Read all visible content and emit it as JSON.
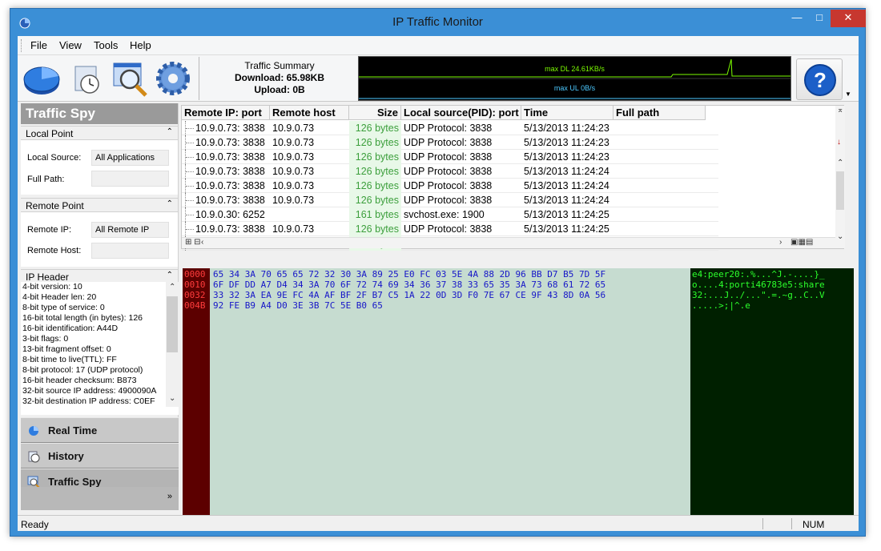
{
  "window": {
    "title": "IP Traffic Monitor"
  },
  "menu": {
    "items": [
      "File",
      "View",
      "Tools",
      "Help"
    ]
  },
  "toolbar": {
    "summary_title": "Traffic Summary",
    "download": "Download: 65.98KB",
    "upload": "Upload: 0B",
    "graph_dl": "max DL 24.61KB/s",
    "graph_ul": "max UL 0B/s",
    "icons": [
      "pie-chart-icon",
      "clock-icon",
      "magnifier-icon",
      "gear-icon",
      "help-icon"
    ]
  },
  "sidebar": {
    "title": "Traffic Spy",
    "local_point": {
      "header": "Local Point",
      "source_label": "Local Source:",
      "source_value": "All Applications",
      "path_label": "Full Path:",
      "path_value": ""
    },
    "remote_point": {
      "header": "Remote Point",
      "ip_label": "Remote IP:",
      "ip_value": "All Remote IP",
      "host_label": "Remote Host:",
      "host_value": ""
    },
    "ip_header": {
      "header": "IP Header",
      "lines": [
        "4-bit version: 10",
        "4-bit Header len: 20",
        "8-bit type of service: 0",
        "16-bit total length (in bytes): 126",
        "16-bit identification: A44D",
        "3-bit flags: 0",
        "13-bit fragment offset: 0",
        "8-bit time to live(TTL): FF",
        "8-bit protocol: 17 (UDP protocol)",
        "16-bit header checksum: B873",
        "32-bit source IP address: 4900090A",
        "32-bit destination IP address: C0EF"
      ]
    },
    "nav": [
      "Real Time",
      "History",
      "Traffic Spy"
    ]
  },
  "table": {
    "columns": [
      "Remote IP: port",
      "Remote host",
      "Size",
      "Local source(PID): port",
      "Time",
      "Full path"
    ],
    "rows": [
      [
        "10.9.0.73: 3838",
        "10.9.0.73",
        "126 bytes",
        "UDP Protocol: 3838",
        "5/13/2013 11:24:23",
        ""
      ],
      [
        "10.9.0.73: 3838",
        "10.9.0.73",
        "126 bytes",
        "UDP Protocol: 3838",
        "5/13/2013 11:24:23",
        ""
      ],
      [
        "10.9.0.73: 3838",
        "10.9.0.73",
        "126 bytes",
        "UDP Protocol: 3838",
        "5/13/2013 11:24:23",
        ""
      ],
      [
        "10.9.0.73: 3838",
        "10.9.0.73",
        "126 bytes",
        "UDP Protocol: 3838",
        "5/13/2013 11:24:24",
        ""
      ],
      [
        "10.9.0.73: 3838",
        "10.9.0.73",
        "126 bytes",
        "UDP Protocol: 3838",
        "5/13/2013 11:24:24",
        ""
      ],
      [
        "10.9.0.73: 3838",
        "10.9.0.73",
        "126 bytes",
        "UDP Protocol: 3838",
        "5/13/2013 11:24:24",
        ""
      ],
      [
        "10.9.0.30: 6252",
        "",
        "161 bytes",
        "svchost.exe: 1900",
        "5/13/2013 11:24:25",
        ""
      ],
      [
        "10.9.0.73: 3838",
        "10.9.0.73",
        "126 bytes",
        "UDP Protocol: 3838",
        "5/13/2013 11:24:25",
        ""
      ],
      [
        "10.9.0.73: 3838",
        "10.9.0.73",
        "126 bytes",
        "UDP Protocol: 3838",
        "5/13/2013 11:24:25",
        ""
      ]
    ]
  },
  "hex": {
    "offsets": [
      "0000",
      "0010",
      "0032",
      "004B"
    ],
    "bytes": [
      "65 34 3A 70 65 65 72 32 30 3A 89 25 E0 FC 03 5E 4A 88 2D 96 BB D7 B5 7D 5F",
      "6F DF DD A7 D4 34 3A 70 6F 72 74 69 34 36 37 38 33 65 35 3A 73 68 61 72 65",
      "33 32 3A EA 9E FC 4A AF BF 2F B7 C5 1A 22 0D 3D F0 7E 67 CE 9F 43 8D 0A 56",
      "92 FE B9 A4 D0 3E 3B 7C 5E B0 65"
    ],
    "ascii": [
      "e4:peer20:.%...^J.-....}_",
      "o....4:porti46783e5:share",
      "32:...J../...\".=.~g..C..V",
      ".....>;|^.e"
    ]
  },
  "status": {
    "text": "Ready",
    "num": "NUM"
  }
}
